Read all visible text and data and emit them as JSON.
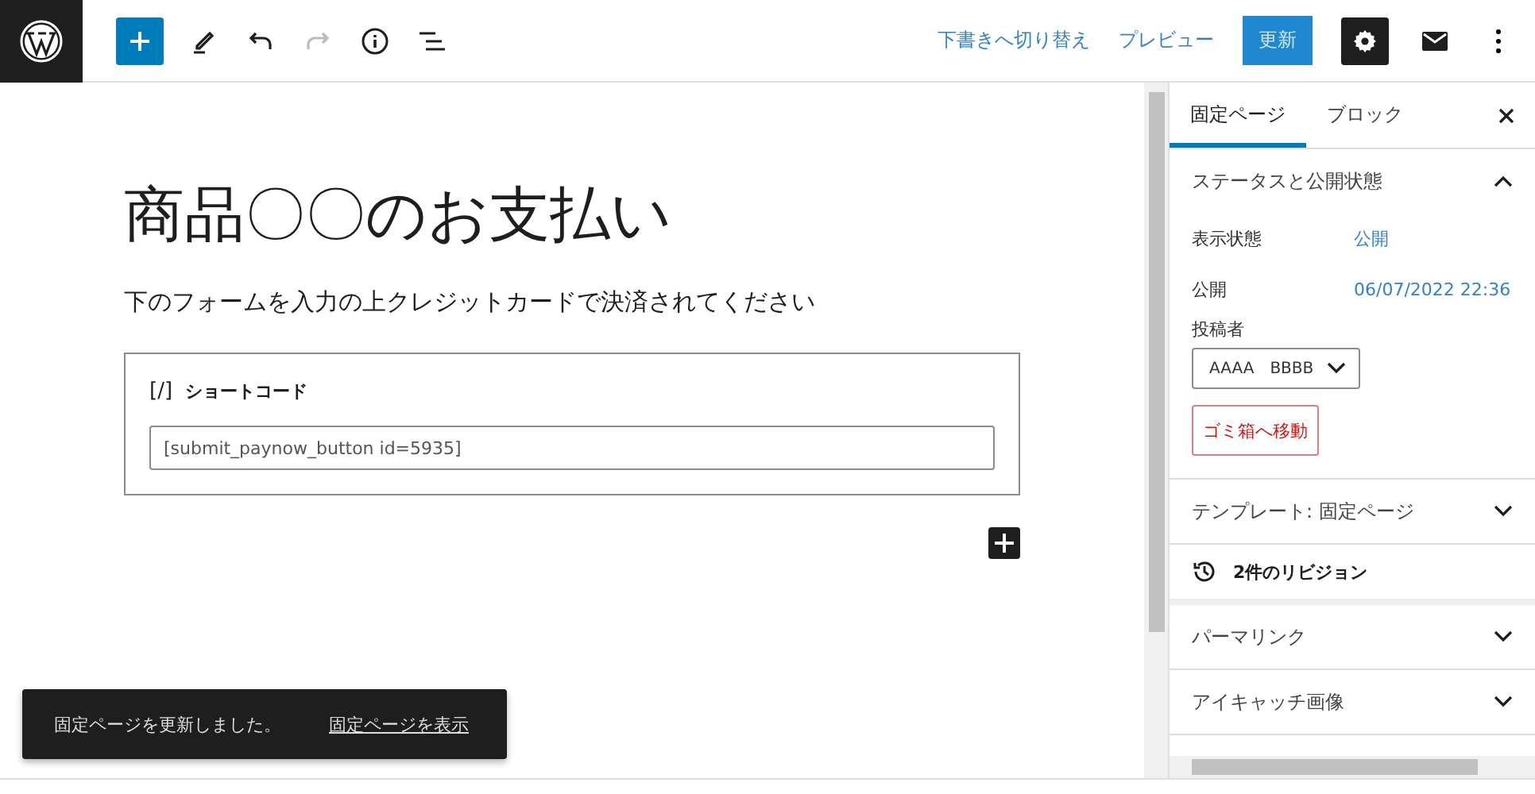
{
  "toolbar": {
    "actions": [
      {
        "label": "下書きへ切り替え",
        "kind": "link"
      },
      {
        "label": "プレビュー",
        "kind": "link"
      },
      {
        "label": "更新",
        "kind": "primary"
      }
    ]
  },
  "editor": {
    "title": "商品〇〇のお支払い",
    "paragraph": "下のフォームを入力の上クレジットカードで決済されてください",
    "block": {
      "icon_text": "[/]",
      "label": "ショートコード",
      "value": "[submit_paynow_button id=5935]"
    }
  },
  "sidebar": {
    "tabs": [
      {
        "label": "固定ページ",
        "selected": true
      },
      {
        "label": "ブロック",
        "selected": false
      }
    ],
    "panels": [
      {
        "kind": "panel",
        "title": "ステータスと公開状態",
        "expanded": true,
        "rows": [
          {
            "label": "表示状態",
            "value": "公開"
          },
          {
            "label": "公開",
            "value": "06/07/2022 22:36"
          }
        ],
        "author_label": "投稿者",
        "author": "AAAA　BBBB",
        "trash": "ゴミ箱へ移動"
      },
      {
        "kind": "panel",
        "title": "テンプレート: 固定ページ",
        "expanded": false
      },
      {
        "kind": "revisions",
        "title": "2件のリビジョン"
      },
      {
        "kind": "panel",
        "title": "パーマリンク",
        "expanded": false
      },
      {
        "kind": "panel",
        "title": "アイキャッチ画像",
        "expanded": false
      }
    ]
  },
  "snackbar": {
    "message": "固定ページを更新しました。",
    "link": "固定ページを表示"
  }
}
